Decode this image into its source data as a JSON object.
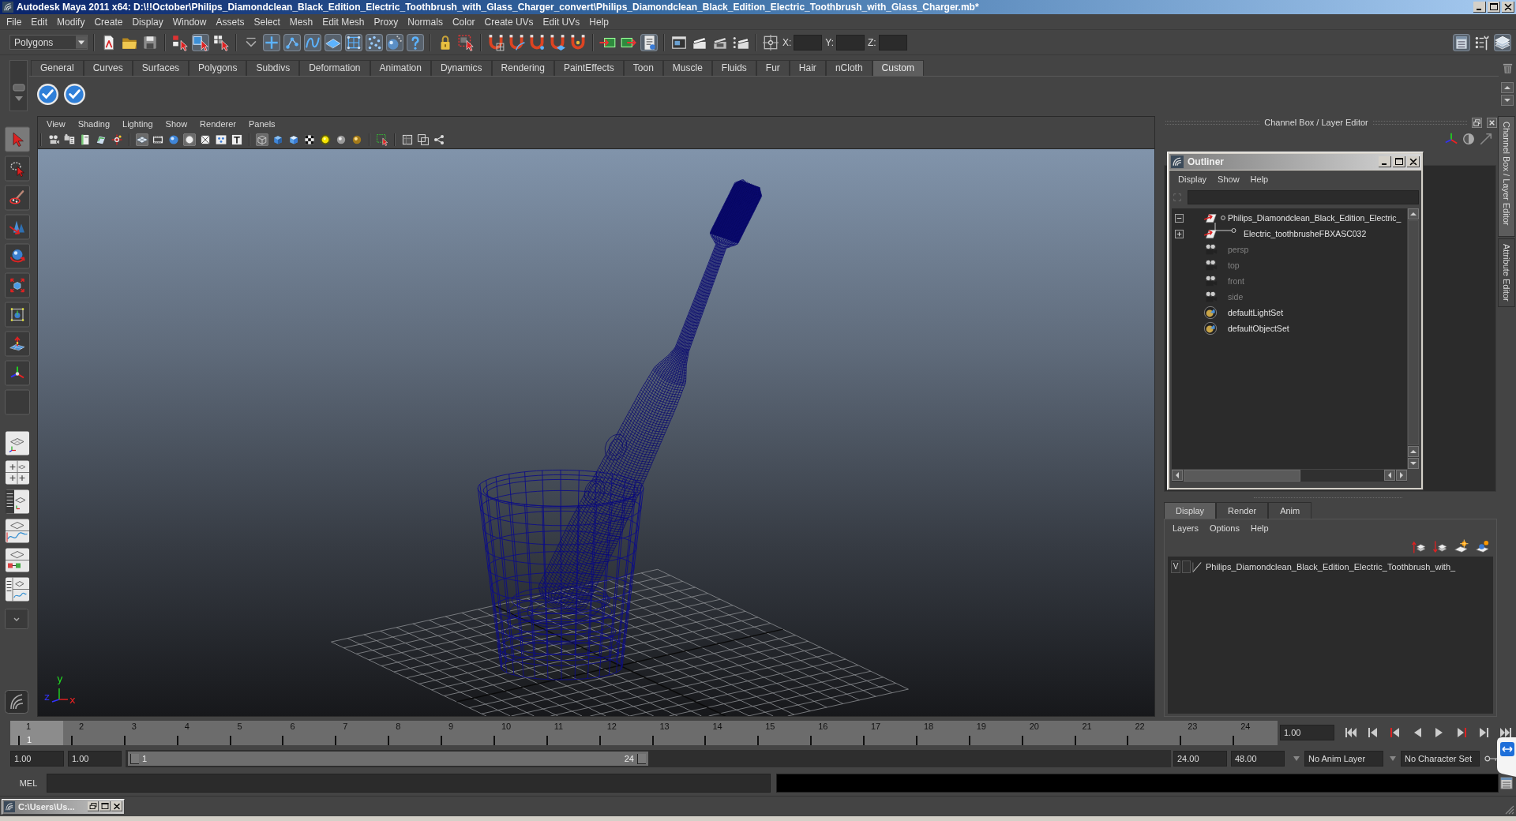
{
  "window": {
    "title": "Autodesk Maya 2011 x64: D:\\!!October\\Philips_Diamondclean_Black_Edition_Electric_Toothbrush_with_Glass_Charger_convert\\Philips_Diamondclean_Black_Edition_Electric_Toothbrush_with_Glass_Charger.mb*"
  },
  "menu_bar": [
    "File",
    "Edit",
    "Modify",
    "Create",
    "Display",
    "Window",
    "Assets",
    "Select",
    "Mesh",
    "Edit Mesh",
    "Proxy",
    "Normals",
    "Color",
    "Create UVs",
    "Edit UVs",
    "Help"
  ],
  "status_line": {
    "mode": "Polygons",
    "tool_groups": [
      [
        {
          "kind": "new",
          "pressed": false
        },
        {
          "kind": "open",
          "pressed": false
        },
        {
          "kind": "save",
          "pressed": false
        }
      ],
      [
        {
          "kind": "hierarchy",
          "pressed": false
        },
        {
          "kind": "object",
          "pressed": true
        },
        {
          "kind": "component",
          "pressed": false
        }
      ],
      [
        {
          "kind": "filter",
          "pressed": false
        },
        {
          "kind": "handle",
          "pressed": true
        },
        {
          "kind": "joint",
          "pressed": true
        },
        {
          "kind": "curve",
          "pressed": true
        },
        {
          "kind": "surface",
          "pressed": true
        },
        {
          "kind": "deform",
          "pressed": true
        },
        {
          "kind": "dynamic",
          "pressed": true
        },
        {
          "kind": "render",
          "pressed": true
        },
        {
          "kind": "misc",
          "pressed": true
        }
      ],
      [
        {
          "kind": "lock",
          "pressed": false
        },
        {
          "kind": "highlight",
          "pressed": false
        }
      ],
      [
        {
          "kind": "snapgrid",
          "pressed": false
        },
        {
          "kind": "snapcurve",
          "pressed": false
        },
        {
          "kind": "snappoint",
          "pressed": false
        },
        {
          "kind": "snapplane",
          "pressed": false
        },
        {
          "kind": "snaplive",
          "pressed": false
        }
      ],
      [
        {
          "kind": "inputs",
          "pressed": false
        },
        {
          "kind": "outputs",
          "pressed": false
        },
        {
          "kind": "history",
          "pressed": true
        }
      ],
      [
        {
          "kind": "renderview",
          "pressed": false
        },
        {
          "kind": "renderframe",
          "pressed": false
        },
        {
          "kind": "ipr",
          "pressed": false
        },
        {
          "kind": "rendersettings",
          "pressed": false
        }
      ],
      [
        {
          "kind": "snapsel",
          "pressed": false
        }
      ]
    ],
    "coordinates": [
      {
        "label": "X:"
      },
      {
        "label": "Y:"
      },
      {
        "label": "Z:"
      }
    ],
    "panel_toggles": [
      {
        "kind": "attributes",
        "pressed": true
      },
      {
        "kind": "toolsettings",
        "pressed": false
      },
      {
        "kind": "channels",
        "pressed": true
      }
    ]
  },
  "shelf": {
    "tabs": [
      {
        "label": "General",
        "selected": false
      },
      {
        "label": "Curves",
        "selected": false
      },
      {
        "label": "Surfaces",
        "selected": false
      },
      {
        "label": "Polygons",
        "selected": false
      },
      {
        "label": "Subdivs",
        "selected": false
      },
      {
        "label": "Deformation",
        "selected": false
      },
      {
        "label": "Animation",
        "selected": false
      },
      {
        "label": "Dynamics",
        "selected": false
      },
      {
        "label": "Rendering",
        "selected": false
      },
      {
        "label": "PaintEffects",
        "selected": false
      },
      {
        "label": "Toon",
        "selected": false
      },
      {
        "label": "Muscle",
        "selected": false
      },
      {
        "label": "Fluids",
        "selected": false
      },
      {
        "label": "Fur",
        "selected": false
      },
      {
        "label": "Hair",
        "selected": false
      },
      {
        "label": "nCloth",
        "selected": false
      },
      {
        "label": "Custom",
        "selected": true
      }
    ]
  },
  "toolbox": {
    "tools": [
      {
        "kind": "select",
        "selected": true
      },
      {
        "kind": "lasso",
        "selected": false
      },
      {
        "kind": "paint",
        "selected": false
      },
      {
        "kind": "move",
        "selected": false
      },
      {
        "kind": "rotate",
        "selected": false
      },
      {
        "kind": "scale",
        "selected": false
      },
      {
        "kind": "universal",
        "selected": false
      },
      {
        "kind": "softmod",
        "selected": false
      },
      {
        "kind": "showmanip",
        "selected": false
      },
      {
        "kind": "last",
        "selected": false
      }
    ],
    "layouts": [
      {
        "kind": "single"
      },
      {
        "kind": "four"
      },
      {
        "kind": "outliner"
      },
      {
        "kind": "graph"
      },
      {
        "kind": "hypershade"
      },
      {
        "kind": "three"
      }
    ]
  },
  "viewport": {
    "menu": [
      "View",
      "Shading",
      "Lighting",
      "Show",
      "Renderer",
      "Panels"
    ],
    "icon_groups": [
      [
        {
          "kind": "camera",
          "pressed": false
        },
        {
          "kind": "camattr",
          "pressed": false
        },
        {
          "kind": "bookmark",
          "pressed": false
        },
        {
          "kind": "imageplane",
          "pressed": false
        },
        {
          "kind": "pivot",
          "pressed": false
        }
      ],
      [
        {
          "kind": "grid",
          "pressed": true
        },
        {
          "kind": "filmgate",
          "pressed": false
        },
        {
          "kind": "resgate",
          "pressed": false
        },
        {
          "kind": "gatemask",
          "pressed": true
        },
        {
          "kind": "fieldchart",
          "pressed": false
        },
        {
          "kind": "safeaction",
          "pressed": false
        },
        {
          "kind": "safetitle",
          "pressed": false
        }
      ],
      [
        {
          "kind": "wire",
          "pressed": true
        },
        {
          "kind": "smooth",
          "pressed": false
        },
        {
          "kind": "lit",
          "pressed": false
        },
        {
          "kind": "textured",
          "pressed": false
        },
        {
          "kind": "lights",
          "pressed": false
        },
        {
          "kind": "shadows",
          "pressed": false
        },
        {
          "kind": "hq",
          "pressed": false
        }
      ],
      [
        {
          "kind": "isolate",
          "pressed": false
        }
      ],
      [
        {
          "kind": "xray",
          "pressed": false
        },
        {
          "kind": "xrayjoints",
          "pressed": false
        },
        {
          "kind": "xraycomp",
          "pressed": false
        }
      ]
    ],
    "axis_labels": [
      "y",
      "z",
      "x"
    ]
  },
  "channel_box": {
    "title": "Channel Box / Layer Editor"
  },
  "outliner": {
    "title": "Outliner",
    "menu": [
      "Display",
      "Show",
      "Help"
    ],
    "items": [
      {
        "name": "Philips_Diamondclean_Black_Edition_Electric_",
        "kind": "transform",
        "hidden": false,
        "expanded": true,
        "children": [
          {
            "name": "Electric_toothbrusheFBXASC032",
            "kind": "transform",
            "hidden": false,
            "expanded": false
          }
        ]
      },
      {
        "name": "persp",
        "kind": "camera",
        "hidden": true
      },
      {
        "name": "top",
        "kind": "camera",
        "hidden": true
      },
      {
        "name": "front",
        "kind": "camera",
        "hidden": true
      },
      {
        "name": "side",
        "kind": "camera",
        "hidden": true
      },
      {
        "name": "defaultLightSet",
        "kind": "set",
        "hidden": false
      },
      {
        "name": "defaultObjectSet",
        "kind": "set",
        "hidden": false
      }
    ]
  },
  "layer_editor": {
    "tabs": [
      {
        "label": "Display",
        "selected": true
      },
      {
        "label": "Render",
        "selected": false
      },
      {
        "label": "Anim",
        "selected": false
      }
    ],
    "menu": [
      "Layers",
      "Options",
      "Help"
    ],
    "layers": [
      {
        "visibility": "V",
        "name": "Philips_Diamondclean_Black_Edition_Electric_Toothbrush_with_"
      }
    ]
  },
  "side_tabs": [
    {
      "label": "Channel Box / Layer Editor",
      "selected": true
    },
    {
      "label": "Attribute Editor",
      "selected": false
    }
  ],
  "timeline": {
    "ticks": [
      {
        "label": "1",
        "selected": true
      },
      {
        "label": "2",
        "selected": false
      },
      {
        "label": "3",
        "selected": false
      },
      {
        "label": "4",
        "selected": false
      },
      {
        "label": "5",
        "selected": false
      },
      {
        "label": "6",
        "selected": false
      },
      {
        "label": "7",
        "selected": false
      },
      {
        "label": "8",
        "selected": false
      },
      {
        "label": "9",
        "selected": false
      },
      {
        "label": "10",
        "selected": false
      },
      {
        "label": "11",
        "selected": false
      },
      {
        "label": "12",
        "selected": false
      },
      {
        "label": "13",
        "selected": false
      },
      {
        "label": "14",
        "selected": false
      },
      {
        "label": "15",
        "selected": false
      },
      {
        "label": "16",
        "selected": false
      },
      {
        "label": "17",
        "selected": false
      },
      {
        "label": "18",
        "selected": false
      },
      {
        "label": "19",
        "selected": false
      },
      {
        "label": "20",
        "selected": false
      },
      {
        "label": "21",
        "selected": false
      },
      {
        "label": "22",
        "selected": false
      },
      {
        "label": "23",
        "selected": false
      },
      {
        "label": "24",
        "selected": false
      }
    ],
    "current_frame": "1",
    "current_time": "1.00"
  },
  "range_slider": {
    "start": "1.00",
    "playback_start": "1.00",
    "handle_start": "1",
    "handle_end": "24",
    "level": 0.5,
    "playback_end": "24.00",
    "end": "48.00",
    "anim_layer": "No Anim Layer",
    "character_set": "No Character Set"
  },
  "command_line": {
    "language": "MEL"
  },
  "taskbar": {
    "items": [
      {
        "title": "C:\\Users\\Us..."
      }
    ]
  }
}
